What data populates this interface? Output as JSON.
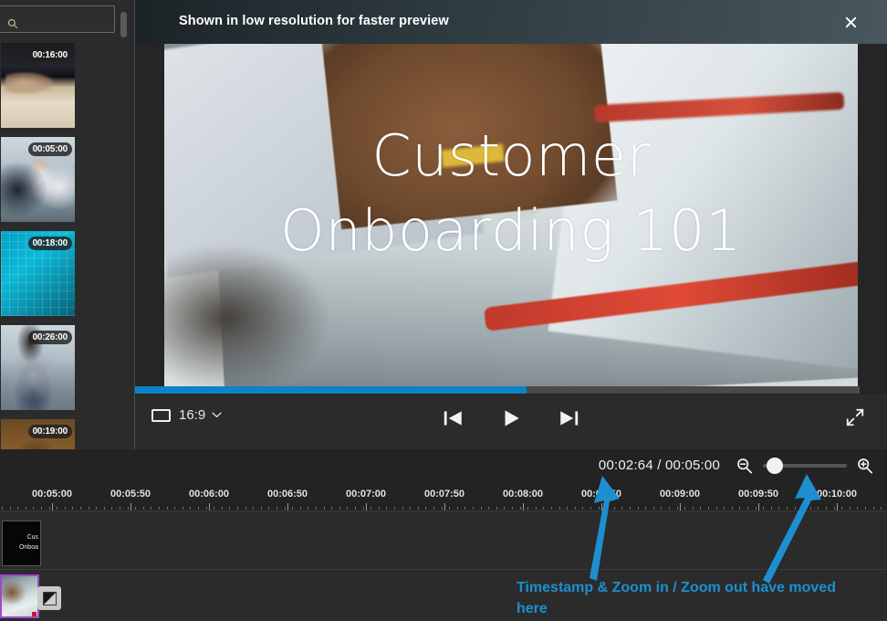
{
  "library": {
    "search": {
      "value": "",
      "placeholder": ""
    },
    "items": [
      {
        "name": "clip-thumbnail-meeting-hands",
        "duration": "00:16:00",
        "art": "art1"
      },
      {
        "name": "clip-thumbnail-office-team",
        "duration": "00:05:00",
        "art": "art2"
      },
      {
        "name": "clip-thumbnail-data-chart",
        "duration": "00:18:00",
        "art": "art3"
      },
      {
        "name": "clip-thumbnail-presenter",
        "duration": "00:26:00",
        "art": "art4"
      },
      {
        "name": "clip-thumbnail-warm-scene",
        "duration": "00:19:00",
        "art": "art5"
      }
    ]
  },
  "preview": {
    "banner": "Shown in low resolution for faster preview",
    "close_label": "✕",
    "video_title_line1": "Customer",
    "video_title_line2": "Onboarding 101",
    "progress_percent": 54
  },
  "controls": {
    "aspect_ratio": "16:9",
    "caret": "⌄",
    "prev_frame_label": "Previous frame",
    "play_label": "Play",
    "next_frame_label": "Next frame",
    "fullscreen_label": "Full screen"
  },
  "toolbar": {
    "timestamp": "00:02:64 / 00:05:00",
    "zoom_out_label": "Zoom out",
    "zoom_in_label": "Zoom in",
    "zoom_value": 4
  },
  "ruler": {
    "labels": [
      "00:05:00",
      "00:05:50",
      "00:06:00",
      "00:06:50",
      "00:07:00",
      "00:07:50",
      "00:08:00",
      "00:08:50",
      "00:09:00",
      "00:09:50",
      "00:10:00"
    ]
  },
  "tracks": {
    "text_clip_line1": "Cus",
    "text_clip_line2": "Onboa",
    "transition_icon": "transition-icon"
  },
  "annotation": {
    "text": "Timestamp & Zoom in / Zoom out have moved here",
    "color": "#1d8fd1"
  },
  "colors": {
    "accent_blue": "#0b84c4",
    "annotation_blue": "#1d8fd1",
    "clip_selected": "#a347c8",
    "panel_bg": "#2b2b2b",
    "toolbar_bg": "#232323"
  }
}
